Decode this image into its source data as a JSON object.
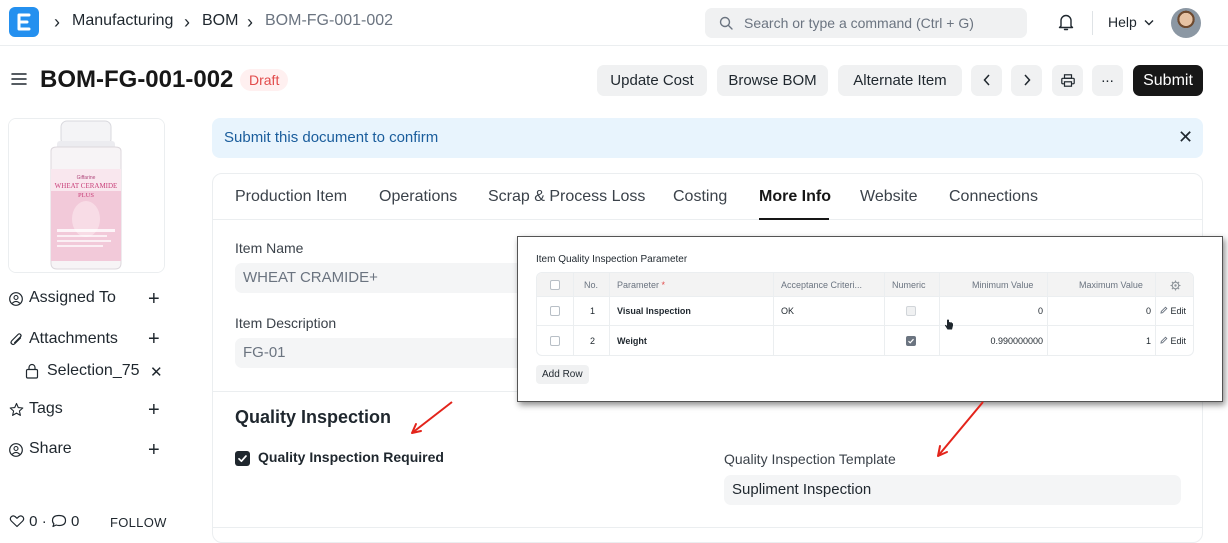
{
  "navbar": {
    "breadcrumbs": [
      "Manufacturing",
      "BOM",
      "BOM-FG-001-002"
    ],
    "search_placeholder": "Search or type a command (Ctrl + G)",
    "help_label": "Help"
  },
  "page": {
    "title": "BOM-FG-001-002",
    "status": "Draft",
    "buttons": {
      "update_cost": "Update Cost",
      "browse_bom": "Browse BOM",
      "alternate_item": "Alternate Item",
      "more": "...",
      "submit": "Submit"
    }
  },
  "sidebar": {
    "image_texts": [
      "Giffarine",
      "WHEAT CERAMIDE",
      "PLUS"
    ],
    "assigned_to": "Assigned To",
    "attachments": "Attachments",
    "attachment_file": "Selection_75",
    "tags": "Tags",
    "share": "Share",
    "likes": "0",
    "comments": "0",
    "dot": "·",
    "follow": "FOLLOW"
  },
  "alert": {
    "message": "Submit this document to confirm"
  },
  "tabs": [
    "Production Item",
    "Operations",
    "Scrap & Process Loss",
    "Costing",
    "More Info",
    "Website",
    "Connections"
  ],
  "active_tab": "More Info",
  "form": {
    "item_name_label": "Item Name",
    "item_name_value": "WHEAT CRAMIDE+",
    "item_description_label": "Item Description",
    "item_description_value": "FG-01",
    "section_title": "Quality Inspection",
    "qi_required_label": "Quality Inspection Required",
    "qi_required_checked": true,
    "qi_template_label": "Quality Inspection Template",
    "qi_template_value": "Supliment Inspection"
  },
  "popup": {
    "title": "Item Quality Inspection Parameter",
    "columns": {
      "no": "No.",
      "parameter": "Parameter",
      "required_mark": "*",
      "acceptance": "Acceptance Criteri...",
      "numeric": "Numeric",
      "min": "Minimum Value",
      "max": "Maximum Value"
    },
    "rows": [
      {
        "no": "1",
        "parameter": "Visual Inspection",
        "acceptance": "OK",
        "numeric": false,
        "min": "0",
        "max": "0",
        "edit": "Edit"
      },
      {
        "no": "2",
        "parameter": "Weight",
        "acceptance": "",
        "numeric": true,
        "min": "0.990000000",
        "max": "1",
        "edit": "Edit"
      }
    ],
    "add_row": "Add Row"
  },
  "colors": {
    "brand": "#2490ef",
    "draft_bg": "#fff0f0",
    "draft_text": "#e24c4c",
    "alert_bg": "#e8f4fd",
    "annotation_arrow": "#e3241b"
  }
}
